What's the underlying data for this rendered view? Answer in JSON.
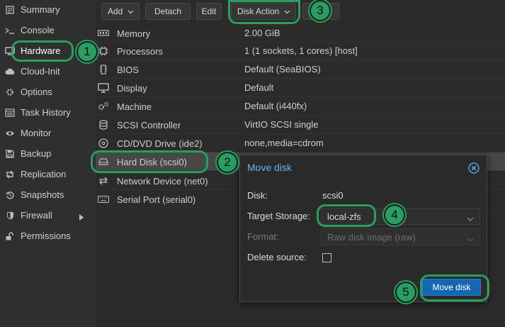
{
  "sidebar": {
    "items": [
      {
        "label": "Summary",
        "icon": "summary-icon"
      },
      {
        "label": "Console",
        "icon": "console-icon"
      },
      {
        "label": "Hardware",
        "icon": "hardware-icon"
      },
      {
        "label": "Cloud-Init",
        "icon": "cloud-icon"
      },
      {
        "label": "Options",
        "icon": "gear-icon"
      },
      {
        "label": "Task History",
        "icon": "list-icon"
      },
      {
        "label": "Monitor",
        "icon": "eye-icon"
      },
      {
        "label": "Backup",
        "icon": "floppy-icon"
      },
      {
        "label": "Replication",
        "icon": "retweet-icon"
      },
      {
        "label": "Snapshots",
        "icon": "history-icon"
      },
      {
        "label": "Firewall",
        "icon": "shield-icon"
      },
      {
        "label": "Permissions",
        "icon": "unlock-icon"
      }
    ],
    "active": "Hardware"
  },
  "toolbar": {
    "add_label": "Add",
    "detach_label": "Detach",
    "edit_label": "Edit",
    "disk_action_label": "Disk Action"
  },
  "hardware": {
    "rows": [
      {
        "key": "Memory",
        "value": "2.00 GiB",
        "icon": "memory-icon"
      },
      {
        "key": "Processors",
        "value": "1 (1 sockets, 1 cores) [host]",
        "icon": "cpu-icon"
      },
      {
        "key": "BIOS",
        "value": "Default (SeaBIOS)",
        "icon": "chip-icon"
      },
      {
        "key": "Display",
        "value": "Default",
        "icon": "desktop-icon"
      },
      {
        "key": "Machine",
        "value": "Default (i440fx)",
        "icon": "cogs-icon"
      },
      {
        "key": "SCSI Controller",
        "value": "VirtIO SCSI single",
        "icon": "database-icon"
      },
      {
        "key": "CD/DVD Drive (ide2)",
        "value": "none,media=cdrom",
        "icon": "cdrom-icon"
      },
      {
        "key": "Hard Disk (scsi0)",
        "value": "",
        "icon": "hdd-icon"
      },
      {
        "key": "Network Device (net0)",
        "value": "",
        "icon": "exchange-icon"
      },
      {
        "key": "Serial Port (serial0)",
        "value": "",
        "icon": "keyboard-icon"
      }
    ]
  },
  "modal": {
    "title": "Move disk",
    "disk_label": "Disk:",
    "disk_value": "scsi0",
    "target_storage_label": "Target Storage:",
    "target_storage_value": "local-zfs",
    "format_label": "Format:",
    "format_value": "Raw disk image (raw)",
    "delete_source_label": "Delete source:",
    "delete_source_checked": false,
    "submit_label": "Move disk"
  },
  "annotations": [
    "1",
    "2",
    "3",
    "4",
    "5"
  ],
  "colors": {
    "accent_blue": "#62b6f0",
    "primary_button": "#1667b2",
    "annotation_green": "#2a9d60"
  }
}
